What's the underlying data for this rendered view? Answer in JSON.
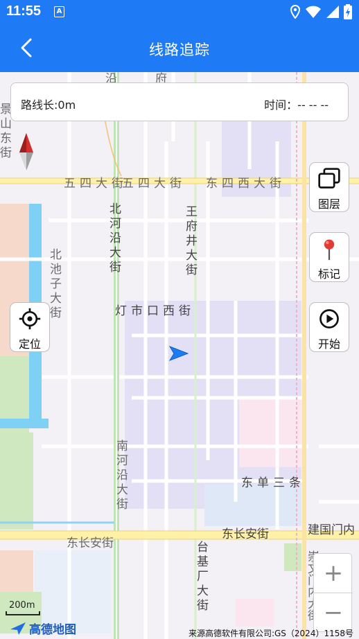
{
  "status": {
    "time": "11:55",
    "app_icon": "A"
  },
  "header": {
    "title": "线路追踪"
  },
  "info": {
    "length": "路线长:0m",
    "time": "时间：-- -- --"
  },
  "buttons": {
    "layers": "图层",
    "mark": "标记",
    "start": "开始",
    "locate": "定位"
  },
  "zoom": {
    "in": "+",
    "out": "−"
  },
  "map": {
    "scale": "200m",
    "logo": "高德地图",
    "copyright": "来源高德软件有限公司:GS（2024）1158号",
    "roads": {
      "wusi": "五四大街",
      "wusi2": "五四大街",
      "dongsi": "东四西大街",
      "beiheyan": "北河沿大街",
      "wangfujing": "王府井大街",
      "beichizi": "北池子大街",
      "dengshikou": "灯市口西街",
      "nanheyan": "南河沿大街",
      "dongdan": "东单三条",
      "dongchangan_w": "东长安街",
      "dongchangan_e": "东长安街",
      "jianguomen": "建国门内",
      "taijichang": "台基厂大街",
      "chongwenmen": "崇文门内大街",
      "top1": "沿大街",
      "top2": "府街",
      "left1": "景山东街"
    }
  },
  "colors": {
    "primary": "#1e7bf5",
    "mark_red": "#e53935",
    "arrow_blue": "#1d7cf2"
  }
}
